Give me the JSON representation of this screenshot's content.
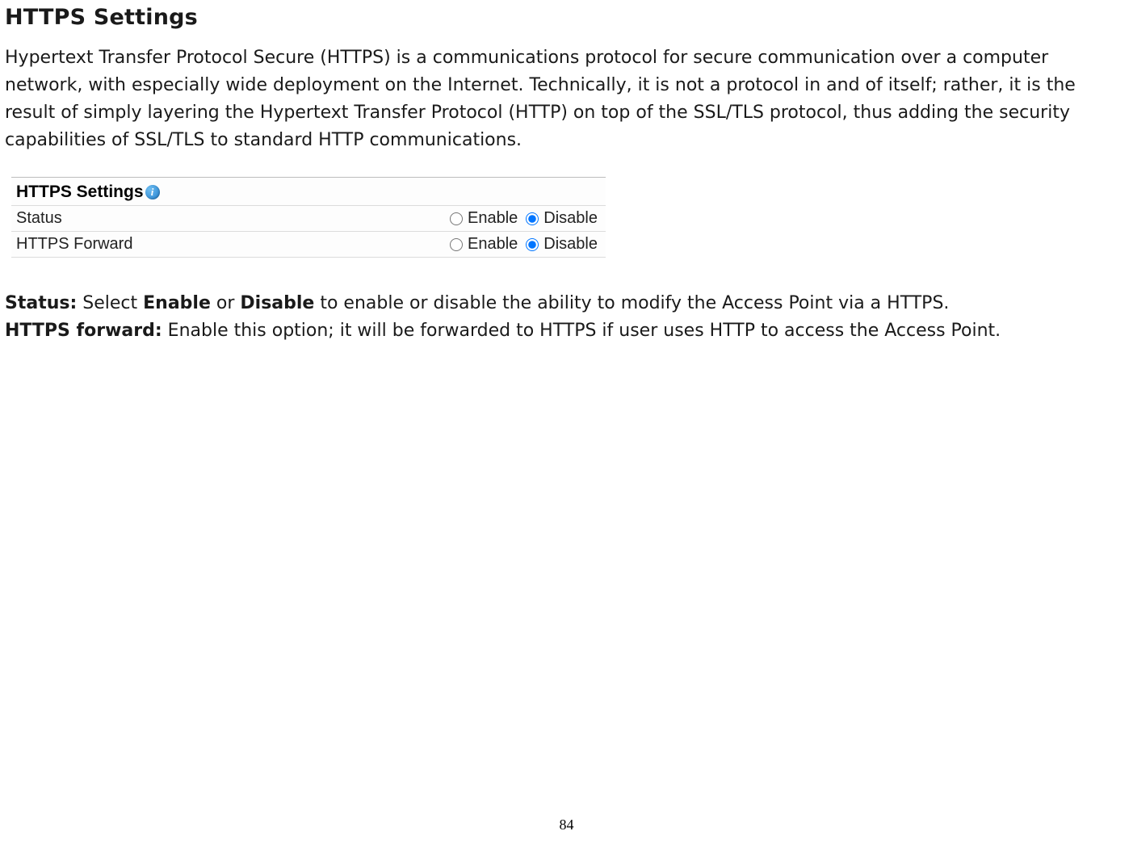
{
  "doc": {
    "heading": "HTTPS Settings",
    "intro": "Hypertext Transfer Protocol Secure (HTTPS) is a communications protocol for secure communication over a computer network, with especially wide deployment on the Internet. Technically, it is not a protocol in and of itself; rather, it is the result of simply layering the Hypertext Transfer Protocol (HTTP) on top of the SSL/TLS protocol, thus adding the security capabilities of SSL/TLS to standard HTTP communications.",
    "page_number": "84"
  },
  "panel": {
    "title": "HTTPS Settings",
    "info_icon_glyph": "i",
    "rows": [
      {
        "label": "Status",
        "enable_label": "Enable",
        "disable_label": "Disable",
        "selected": "disable"
      },
      {
        "label": "HTTPS Forward",
        "enable_label": "Enable",
        "disable_label": "Disable",
        "selected": "disable"
      }
    ]
  },
  "definitions": {
    "status_label": "Status:",
    "status_text_pre": " Select ",
    "status_enable": "Enable",
    "status_or": " or ",
    "status_disable": "Disable",
    "status_text_post": " to enable or disable the ability to modify the Access Point via a HTTPS.",
    "forward_label": "HTTPS forward:",
    "forward_text": " Enable this option; it will be forwarded to HTTPS if user uses HTTP to access the Access Point."
  }
}
